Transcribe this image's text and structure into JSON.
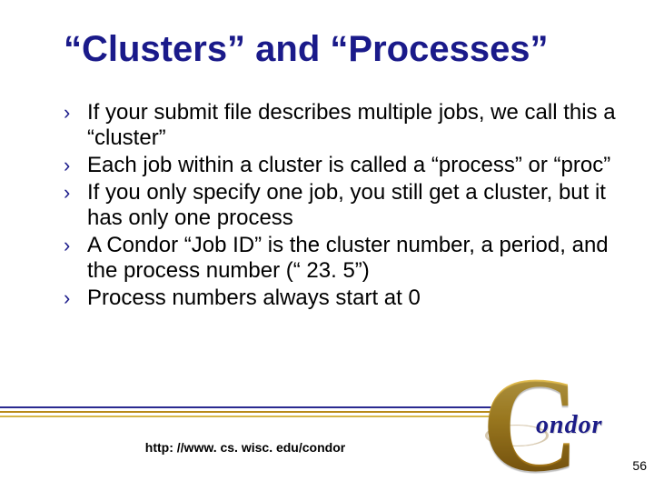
{
  "title": "“Clusters” and “Processes”",
  "bullets": [
    "If your submit file describes multiple jobs, we call this a “cluster”",
    "Each job within a cluster is called a “process” or “proc”",
    "If you only specify one job, you still get a cluster, but it has only one process",
    "A Condor “Job ID” is the cluster number, a period, and the process number (“ 23. 5”)",
    "Process numbers always start at 0"
  ],
  "footer_url": "http: //www. cs. wisc. edu/condor",
  "page_number": "56",
  "bullet_marker": "›",
  "logo": {
    "big_letter": "C",
    "word": "ondor"
  }
}
